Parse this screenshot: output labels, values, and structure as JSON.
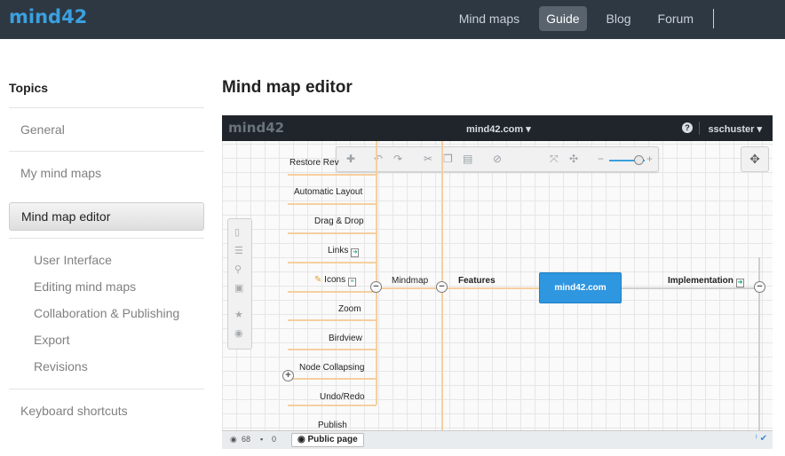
{
  "app": {
    "logo": "mind42"
  },
  "nav": {
    "items": [
      "Mind maps",
      "Guide",
      "Blog",
      "Forum"
    ],
    "active": "Guide"
  },
  "sidebar": {
    "title": "Topics",
    "items": [
      {
        "label": "General"
      },
      {
        "label": "My mind maps"
      },
      {
        "label": "Mind map editor"
      }
    ],
    "subitems": [
      "User Interface",
      "Editing mind maps",
      "Collaboration & Publishing",
      "Export",
      "Revisions"
    ],
    "last": "Keyboard shortcuts"
  },
  "main": {
    "title": "Mind map editor"
  },
  "screenshot": {
    "logo": "mind42",
    "center_title": "mind42.com ▾",
    "user": "sschuster ▾",
    "help": "?",
    "nodes": {
      "restore": "Restore Rev",
      "auto_layout": "Automatic Layout",
      "drag_drop": "Drag & Drop",
      "links": "Links",
      "icons": "Icons",
      "mindmap": "Mindmap",
      "features": "Features",
      "zoom": "Zoom",
      "birdview": "Birdview",
      "node_collapsing": "Node Collapsing",
      "undo_redo": "Undo/Redo",
      "publish": "Publish",
      "center": "mind42.com",
      "implementation": "Implementation"
    },
    "status": {
      "views": "68",
      "comments": "0",
      "public_page": "Public page"
    }
  }
}
